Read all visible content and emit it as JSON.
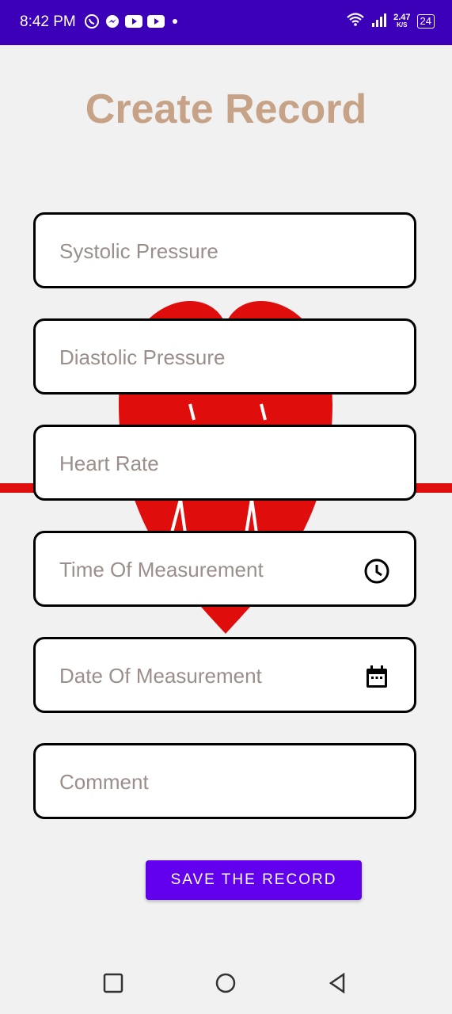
{
  "status_bar": {
    "time": "8:42 PM",
    "speed_value": "2.47",
    "speed_unit": "K/S",
    "battery": "24"
  },
  "title": "Create Record",
  "fields": [
    {
      "placeholder": "Systolic Pressure"
    },
    {
      "placeholder": "Diastolic Pressure"
    },
    {
      "placeholder": "Heart Rate"
    },
    {
      "placeholder": "Time Of Measurement",
      "icon": "clock-icon"
    },
    {
      "placeholder": "Date Of Measurement",
      "icon": "calendar-icon"
    },
    {
      "placeholder": "Comment"
    }
  ],
  "save_button": "SAVE THE RECORD",
  "colors": {
    "status_bar": "#3b00b8",
    "title": "#c6a287",
    "button": "#6200ee",
    "heart": "#e00d0d"
  }
}
